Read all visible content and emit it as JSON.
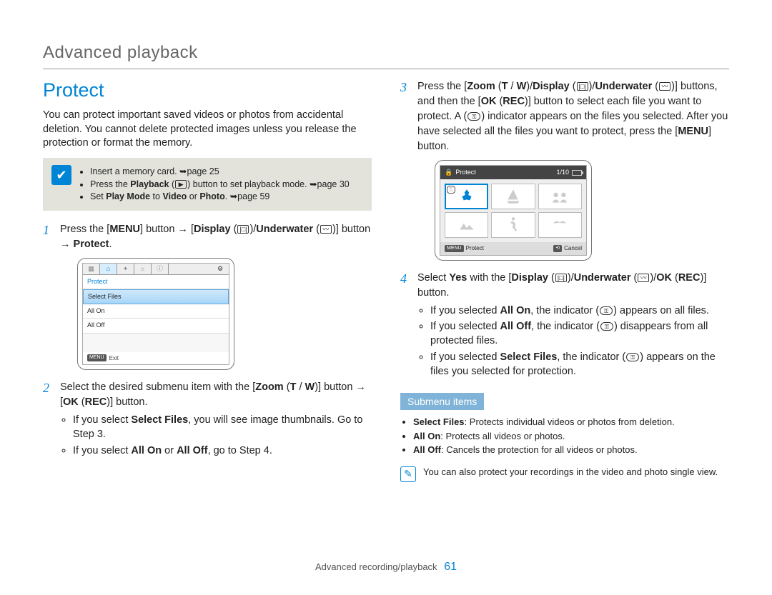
{
  "page_title": "Advanced playback",
  "section_title": "Protect",
  "intro": "You can protect important saved videos or photos from accidental deletion. You cannot delete protected images unless you release the protection or format the memory.",
  "prereq_note": {
    "items": [
      {
        "text_parts": [
          "Insert a memory card. ",
          "➥",
          "page 25"
        ]
      },
      {
        "text_parts": [
          "Press the ",
          "Playback",
          " (",
          "icon",
          ") button to set playback mode. ",
          "➥",
          "page 30"
        ]
      },
      {
        "text_parts": [
          "Set ",
          "Play Mode",
          " to ",
          "Video",
          " or ",
          "Photo",
          ". ",
          "➥",
          "page 59"
        ]
      }
    ]
  },
  "steps_left": [
    {
      "body": "Press the [MENU] button → [Display (|□|)/Underwater (icon)] button → Protect.",
      "bold_map": [
        "MENU",
        "Display",
        "Underwater",
        "Protect"
      ]
    },
    {
      "body": "Select the desired submenu item with the [Zoom (T / W)] button → [OK (REC)] button.",
      "bold_map": [
        "Zoom",
        "T",
        "W",
        "OK",
        "REC"
      ],
      "subs": [
        "If you select Select Files, you will see image thumbnails. Go to Step 3.",
        "If you select All On or All Off, go to Step 4."
      ]
    }
  ],
  "steps_right": [
    {
      "body": "Press the [Zoom (T / W)/Display (|□|)/Underwater (icon)] buttons, and then the [OK (REC)] button to select each file you want to protect. A (key) indicator appears on the files you selected. After you have selected all the files you want to protect, press the [MENU] button.",
      "bold_map": [
        "Zoom",
        "T",
        "W",
        "Display",
        "Underwater",
        "OK",
        "REC",
        "MENU"
      ]
    },
    {
      "body": "Select Yes with the [Display (|□|)/Underwater (icon)/OK (REC)] button.",
      "bold_map": [
        "Yes",
        "Display",
        "Underwater",
        "OK",
        "REC"
      ],
      "subs": [
        "If you selected All On, the indicator (key) appears on all files.",
        "If you selected All Off, the indicator (key) disappears from all protected files.",
        "If you selected Select Files, the indicator (key) appears on the files you selected for protection."
      ]
    }
  ],
  "screenshot1": {
    "title": "Protect",
    "items": [
      "Protect",
      "Select Files",
      "All On",
      "All Off"
    ],
    "footer_label": "Exit",
    "footer_tag": "MENU"
  },
  "screenshot2": {
    "title": "Protect",
    "counter": "1/10",
    "footer_left_tag": "MENU",
    "footer_left": "Protect",
    "footer_right_tag": "⟲",
    "footer_right": "Cancel"
  },
  "submenu_header": "Submenu items",
  "submenu_items": [
    {
      "name": "Select Files",
      "desc": "Protects individual videos or photos from deletion."
    },
    {
      "name": "All On",
      "desc": "Protects all videos or photos."
    },
    {
      "name": "All Off",
      "desc": "Cancels the protection for all videos or photos."
    }
  ],
  "tip_note": "You can also protect your recordings in the video and photo single view.",
  "footer": {
    "section": "Advanced recording/playback",
    "page": "61"
  }
}
